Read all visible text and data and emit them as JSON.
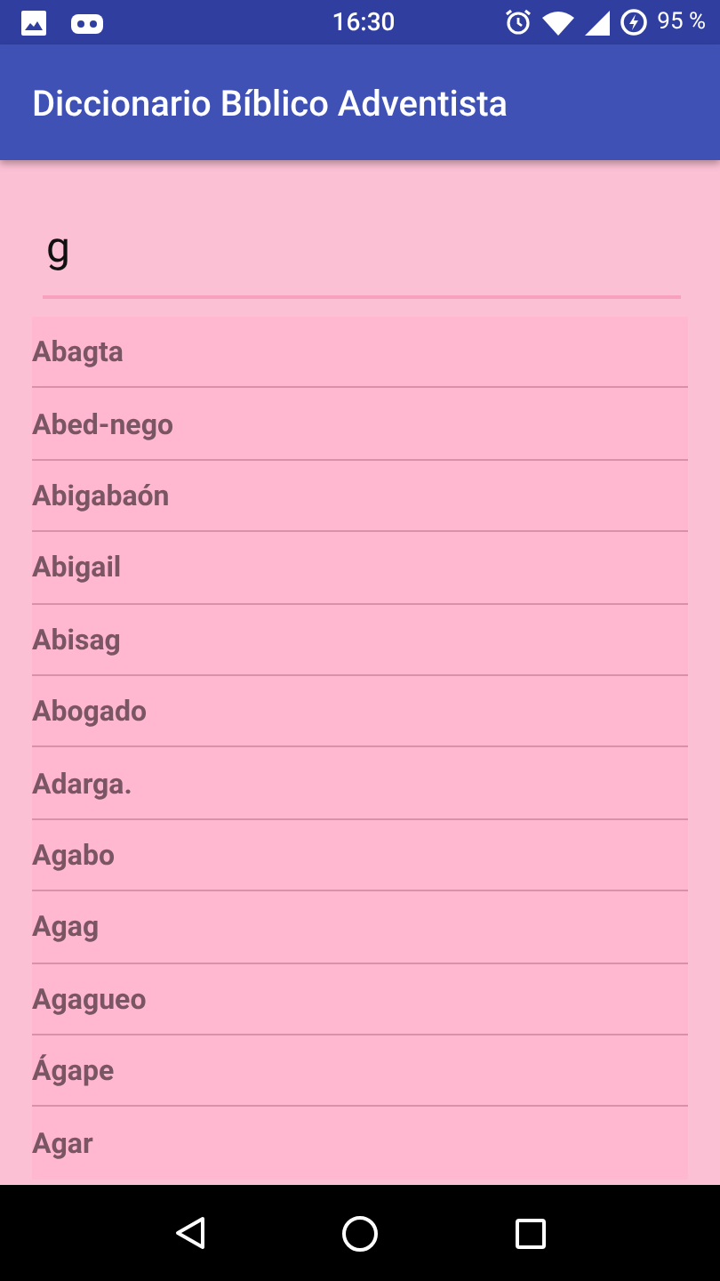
{
  "status_bar": {
    "time": "16:30",
    "battery": "95 %"
  },
  "app_bar": {
    "title": "Diccionario Bíblico Adventista"
  },
  "search": {
    "value": "g"
  },
  "results": [
    {
      "label": "Abagta"
    },
    {
      "label": "Abed-nego"
    },
    {
      "label": "Abigabaón"
    },
    {
      "label": "Abigail"
    },
    {
      "label": "Abisag"
    },
    {
      "label": "Abogado"
    },
    {
      "label": "Adarga."
    },
    {
      "label": "Agabo"
    },
    {
      "label": "Agag"
    },
    {
      "label": "Agagueo"
    },
    {
      "label": "Ágape"
    },
    {
      "label": "Agar"
    }
  ]
}
